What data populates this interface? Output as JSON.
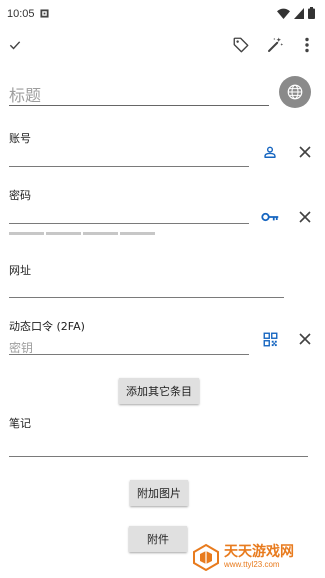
{
  "status_bar": {
    "time": "10:05"
  },
  "form": {
    "title_placeholder": "标题",
    "account_label": "账号",
    "password_label": "密码",
    "url_label": "网址",
    "totp_label": "动态口令 (2FA)",
    "totp_placeholder": "密钥",
    "add_entry_label": "添加其它条目",
    "notes_label": "笔记",
    "add_image_label": "附加图片",
    "attachment_label": "附件"
  },
  "watermark": {
    "title": "天天游戏网",
    "url": "www.ttyl23.com"
  },
  "colors": {
    "accent_blue": "#1565c0",
    "watermark_orange": "#e87b1e",
    "button_gray": "#e0e0e0"
  }
}
